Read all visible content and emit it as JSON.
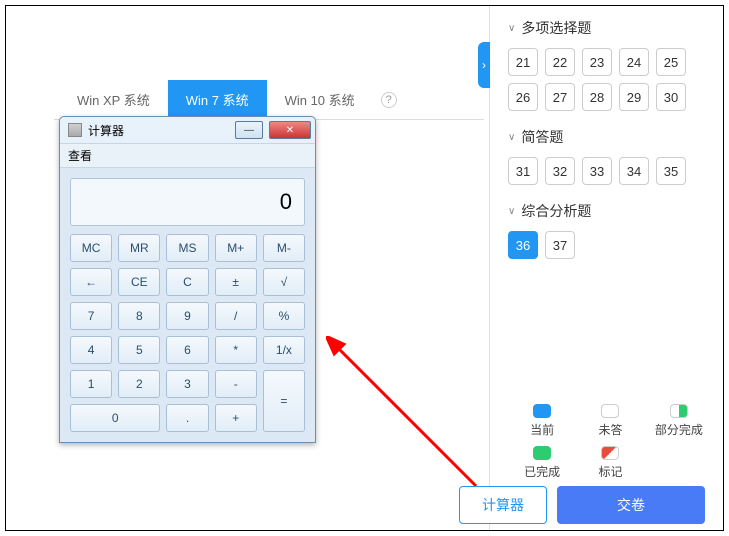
{
  "tabs": {
    "items": [
      "Win XP 系统",
      "Win 7 系统",
      "Win 10 系统"
    ],
    "activeIndex": 1,
    "helpIcon": "?"
  },
  "calculator": {
    "title": "计算器",
    "menu": "查看",
    "display": "0",
    "minimize": "—",
    "close": "✕",
    "buttons": [
      [
        "MC",
        "MR",
        "MS",
        "M+",
        "M-"
      ],
      [
        "←",
        "CE",
        "C",
        "±",
        "√"
      ],
      [
        "7",
        "8",
        "9",
        "/",
        "%"
      ],
      [
        "4",
        "5",
        "6",
        "*",
        "1/x"
      ],
      [
        "1",
        "2",
        "3",
        "-",
        "="
      ],
      [
        "0",
        "",
        "",
        ".",
        "+"
      ]
    ]
  },
  "sidebar": {
    "sections": [
      {
        "title": "多项选择题",
        "questions": [
          21,
          22,
          23,
          24,
          25,
          26,
          27,
          28,
          29,
          30
        ]
      },
      {
        "title": "简答题",
        "questions": [
          31,
          32,
          33,
          34,
          35
        ]
      },
      {
        "title": "综合分析题",
        "questions": [
          36,
          37
        ],
        "currentIndex": 0
      }
    ],
    "legend": {
      "current": "当前",
      "unanswered": "未答",
      "partial": "部分完成",
      "done": "已完成",
      "marked": "标记"
    },
    "collapse": "›"
  },
  "footer": {
    "calculator": "计算器",
    "submit": "交卷"
  }
}
